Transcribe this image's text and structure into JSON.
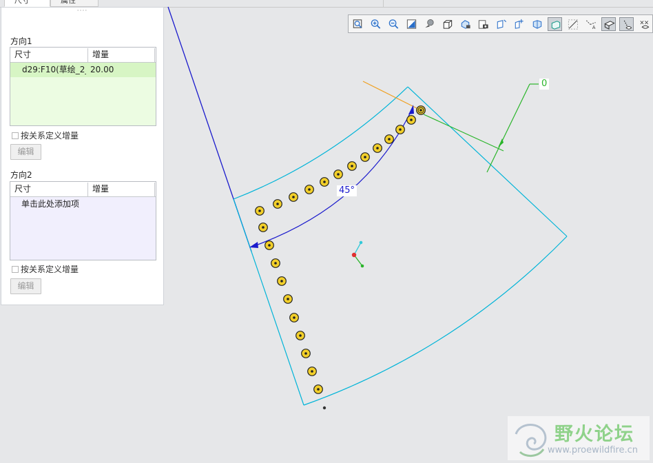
{
  "tabs": [
    {
      "label": "尺寸"
    },
    {
      "label": "属性"
    }
  ],
  "panel": {
    "grip": "····",
    "direction1": {
      "title": "方向1",
      "columns": [
        "尺寸",
        "增量"
      ],
      "rows": [
        {
          "dimension": "d29:F10(草绘_2_",
          "increment": "20.00"
        }
      ],
      "checkbox_label": "按关系定义增量",
      "edit_button": "编辑"
    },
    "direction2": {
      "title": "方向2",
      "columns": [
        "尺寸",
        "增量"
      ],
      "placeholder": "单击此处添加项",
      "checkbox_label": "按关系定义增量",
      "edit_button": "编辑"
    }
  },
  "toolbar": {
    "buttons": [
      {
        "name": "refit-icon",
        "active": false
      },
      {
        "name": "zoom-in-icon",
        "active": false
      },
      {
        "name": "zoom-out-icon",
        "active": false
      },
      {
        "name": "repaint-icon",
        "active": false
      },
      {
        "name": "display-style-icon",
        "active": false
      },
      {
        "name": "saved-orientations-icon",
        "active": false
      },
      {
        "name": "view-manager-icon",
        "active": false
      },
      {
        "name": "perspective-icon",
        "active": false
      },
      {
        "name": "datum-planes-icon",
        "active": false
      },
      {
        "name": "datum-axes-icon",
        "active": false
      },
      {
        "name": "datum-points-icon",
        "active": false
      },
      {
        "name": "coordinate-systems-icon",
        "active": true
      },
      {
        "name": "spin-center-icon",
        "active": false
      },
      {
        "name": "annotations-icon",
        "active": false
      },
      {
        "name": "plane-tag-icon",
        "active": true
      },
      {
        "name": "axis-tag-icon",
        "active": true
      },
      {
        "name": "point-tag-icon",
        "active": false
      }
    ]
  },
  "canvas": {
    "angle_label": "45°",
    "increment_label": "0",
    "colors": {
      "background": "#e6e7e9",
      "sketch_edge": "#00b4d8",
      "datum_axis": "#1a1acc",
      "dimension": "#1a1acc",
      "leader": "#2ab52a",
      "orange_line": "#f0a020",
      "pattern_member_fill": "#f2cf2a"
    }
  },
  "watermark": {
    "title": "野火论坛",
    "url": "www.proewildfire.cn"
  }
}
